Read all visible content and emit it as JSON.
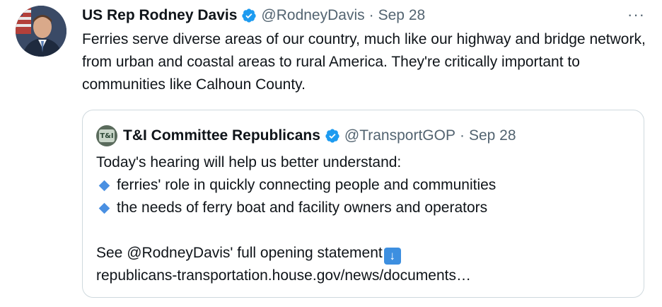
{
  "tweet": {
    "author_name": "US Rep Rodney Davis",
    "handle": "@RodneyDavis",
    "separator": "·",
    "date": "Sep 28",
    "more_label": "···",
    "text": "Ferries serve diverse areas of our country, much like our highway and bridge network, from urban and coastal areas to rural America. They're critically important to communities like Calhoun County."
  },
  "quoted": {
    "author_name": "T&I Committee Republicans",
    "avatar_text": "T&I",
    "handle": "@TransportGOP",
    "separator": "·",
    "date": "Sep 28",
    "intro": "Today's hearing will help us better understand:",
    "bullets": [
      "ferries' role in quickly connecting people and communities",
      "the needs of ferry boat and facility owners and operators"
    ],
    "statement": "See @RodneyDavis' full opening statement",
    "link": "republicans-transportation.house.gov/news/documents…"
  },
  "colors": {
    "verified": "#1d9bf0",
    "muted": "#536471",
    "border": "#cfd9de",
    "bullet_diamond": "#4a90e2"
  },
  "icons": {
    "verified": "verified-badge-icon",
    "more": "more-options-icon",
    "bullet": "blue-diamond-icon",
    "arrow": "down-arrow-emoji-icon"
  }
}
